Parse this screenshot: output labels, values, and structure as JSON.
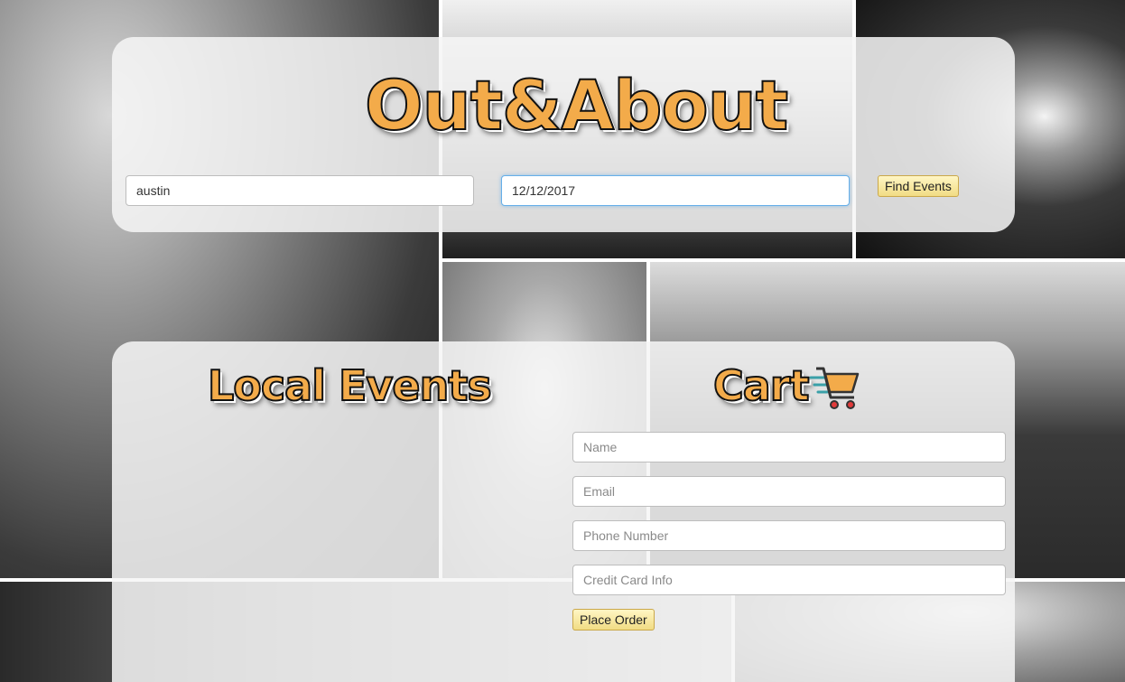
{
  "header": {
    "logo_text": "Out&About"
  },
  "search": {
    "city_value": "austin",
    "date_value": "12/12/2017",
    "find_button_label": "Find Events"
  },
  "events": {
    "heading": "Local Events"
  },
  "cart": {
    "heading": "Cart",
    "icon": "shopping-cart-icon",
    "name_placeholder": "Name",
    "email_placeholder": "Email",
    "phone_placeholder": "Phone Number",
    "card_placeholder": "Credit Card Info",
    "place_order_label": "Place Order"
  },
  "colors": {
    "heading_orange": "#f3ab4a",
    "button_gold": "#f1dc84",
    "focus_blue": "#66afe9"
  }
}
